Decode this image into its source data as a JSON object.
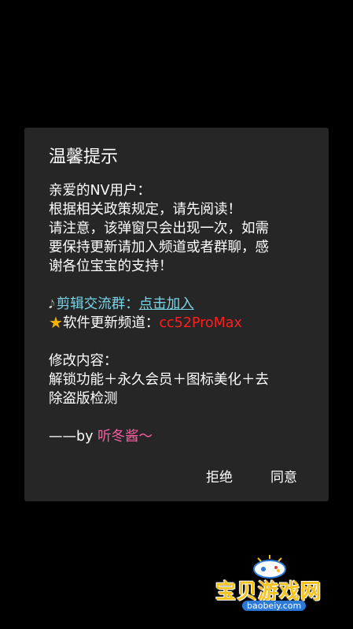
{
  "dialog": {
    "title": "温馨提示",
    "greeting": "亲爱的NV用户：",
    "notice_line1": "根据相关政策规定，请先阅读！",
    "notice_line2": "请注意，该弹窗只会出现一次，如需",
    "notice_line3": "要保持更新请加入频道或者群聊，感",
    "notice_line4": "谢各位宝宝的支持！",
    "group_label": "剪辑交流群：",
    "group_link": "点击加入",
    "channel_label": "软件更新频道：",
    "channel_value": "cc52ProMax",
    "changes_heading": "修改内容：",
    "changes_line1": "解锁功能＋永久会员＋图标美化＋去",
    "changes_line2": "除盗版检测",
    "signature_prefix": "——by ",
    "signature_name": "听冬酱～",
    "reject_label": "拒绝",
    "agree_label": "同意"
  },
  "watermark": {
    "brand": "宝贝游戏网",
    "url": "baobeiy.com"
  },
  "colors": {
    "dialog_bg": "#262626",
    "link": "#7ad4e6",
    "channel": "#ff1e1e",
    "signature": "#ff5fa2",
    "star": "#f5b301"
  },
  "icons": {
    "group": "guitar-icon",
    "channel": "star-icon"
  }
}
